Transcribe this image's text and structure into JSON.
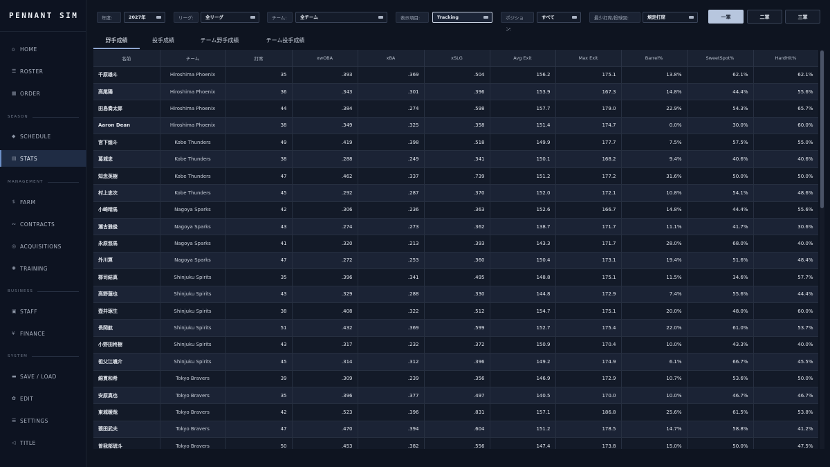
{
  "app": {
    "title": "PENNANT SIM"
  },
  "nav": {
    "home": "HOME",
    "roster": "ROSTER",
    "order": "ORDER",
    "season_section": "SEASON",
    "schedule": "SCHEDULE",
    "stats": "STATS",
    "management_section": "MANAGEMENT",
    "farm": "FARM",
    "contracts": "CONTRACTS",
    "acquisitions": "ACQUISITIONS",
    "training": "TRAINING",
    "business_section": "BUSINESS",
    "staff": "STAFF",
    "finance": "FINANCE",
    "system_section": "SYSTEM",
    "save_load": "SAVE / LOAD",
    "edit": "EDIT",
    "settings": "SETTINGS",
    "title": "TITLE"
  },
  "filters": {
    "year_label": "年度:",
    "year_value": "2027年",
    "league_label": "リーグ:",
    "league_value": "全リーグ",
    "team_label": "チーム:",
    "team_value": "全チーム",
    "display_label": "表示項目:",
    "display_value": "Tracking",
    "position_label": "ポジション:",
    "position_value": "すべて",
    "min_label": "最少打席/投球回:",
    "min_value": "規定打席",
    "group1": "一軍",
    "group2": "二軍",
    "group3": "三軍"
  },
  "tabs": {
    "batting": "野手成績",
    "pitching": "投手成績",
    "team_batting": "チーム野手成績",
    "team_pitching": "チーム投手成績"
  },
  "table": {
    "headers": [
      "名前",
      "チーム",
      "打席",
      "xwOBA",
      "xBA",
      "xSLG",
      "Avg Exit",
      "Max Exit",
      "Barrel%",
      "SweetSpot%",
      "HardHit%"
    ],
    "rows": [
      [
        "千原雄斗",
        "Hiroshima Phoenix",
        "35",
        ".393",
        ".369",
        ".504",
        "156.2",
        "175.1",
        "13.8%",
        "62.1%",
        "62.1%"
      ],
      [
        "高尾陽",
        "Hiroshima Phoenix",
        "36",
        ".343",
        ".301",
        ".396",
        "153.9",
        "167.3",
        "14.8%",
        "44.4%",
        "55.6%"
      ],
      [
        "田島奏太郎",
        "Hiroshima Phoenix",
        "44",
        ".384",
        ".274",
        ".598",
        "157.7",
        "179.0",
        "22.9%",
        "54.3%",
        "65.7%"
      ],
      [
        "Aaron Dean",
        "Hiroshima Phoenix",
        "38",
        ".349",
        ".325",
        ".358",
        "151.4",
        "174.7",
        "0.0%",
        "30.0%",
        "60.0%"
      ],
      [
        "宮下煌斗",
        "Kobe Thunders",
        "49",
        ".419",
        ".398",
        ".518",
        "149.9",
        "177.7",
        "7.5%",
        "57.5%",
        "55.0%"
      ],
      [
        "葛城忠",
        "Kobe Thunders",
        "38",
        ".288",
        ".249",
        ".341",
        "150.1",
        "168.2",
        "9.4%",
        "40.6%",
        "40.6%"
      ],
      [
        "知念英樹",
        "Kobe Thunders",
        "47",
        ".462",
        ".337",
        ".739",
        "151.2",
        "177.2",
        "31.6%",
        "50.0%",
        "50.0%"
      ],
      [
        "村上忠次",
        "Kobe Thunders",
        "45",
        ".292",
        ".287",
        ".370",
        "152.0",
        "172.1",
        "10.8%",
        "54.1%",
        "48.6%"
      ],
      [
        "小崎晴馬",
        "Nagoya Sparks",
        "42",
        ".306",
        ".236",
        ".363",
        "152.6",
        "166.7",
        "14.8%",
        "44.4%",
        "55.6%"
      ],
      [
        "瀬古雅俊",
        "Nagoya Sparks",
        "43",
        ".274",
        ".273",
        ".362",
        "138.7",
        "171.7",
        "11.1%",
        "41.7%",
        "30.6%"
      ],
      [
        "永原悠馬",
        "Nagoya Sparks",
        "41",
        ".320",
        ".213",
        ".393",
        "143.3",
        "171.7",
        "28.0%",
        "68.0%",
        "40.0%"
      ],
      [
        "外川算",
        "Nagoya Sparks",
        "47",
        ".272",
        ".253",
        ".360",
        "150.4",
        "173.1",
        "19.4%",
        "51.6%",
        "48.4%"
      ],
      [
        "郡司結真",
        "Shinjuku Spirits",
        "35",
        ".396",
        ".341",
        ".495",
        "148.8",
        "175.1",
        "11.5%",
        "34.6%",
        "57.7%"
      ],
      [
        "高野蓮也",
        "Shinjuku Spirits",
        "43",
        ".329",
        ".288",
        ".330",
        "144.8",
        "172.9",
        "7.4%",
        "55.6%",
        "44.4%"
      ],
      [
        "壺井琢生",
        "Shinjuku Spirits",
        "38",
        ".408",
        ".322",
        ".512",
        "154.7",
        "175.1",
        "20.0%",
        "48.0%",
        "60.0%"
      ],
      [
        "長岡航",
        "Shinjuku Spirits",
        "51",
        ".432",
        ".369",
        ".599",
        "152.7",
        "175.4",
        "22.0%",
        "61.0%",
        "53.7%"
      ],
      [
        "小野田柊樹",
        "Shinjuku Spirits",
        "43",
        ".317",
        ".232",
        ".372",
        "150.9",
        "170.4",
        "10.0%",
        "43.3%",
        "40.0%"
      ],
      [
        "祖父江颯介",
        "Shinjuku Spirits",
        "45",
        ".314",
        ".312",
        ".396",
        "149.2",
        "174.9",
        "6.1%",
        "66.7%",
        "45.5%"
      ],
      [
        "綿貫和希",
        "Tokyo Bravers",
        "39",
        ".309",
        ".239",
        ".356",
        "146.9",
        "172.9",
        "10.7%",
        "53.6%",
        "50.0%"
      ],
      [
        "安原真也",
        "Tokyo Bravers",
        "35",
        ".396",
        ".377",
        ".497",
        "140.5",
        "170.0",
        "10.0%",
        "46.7%",
        "46.7%"
      ],
      [
        "東城暖哉",
        "Tokyo Bravers",
        "42",
        ".523",
        ".396",
        ".831",
        "157.1",
        "186.8",
        "25.6%",
        "61.5%",
        "53.8%"
      ],
      [
        "蓑田武夫",
        "Tokyo Bravers",
        "47",
        ".470",
        ".394",
        ".604",
        "151.2",
        "178.5",
        "14.7%",
        "58.8%",
        "41.2%"
      ],
      [
        "曽我部琥斗",
        "Tokyo Bravers",
        "50",
        ".453",
        ".382",
        ".556",
        "147.4",
        "173.8",
        "15.0%",
        "50.0%",
        "47.5%"
      ]
    ]
  }
}
